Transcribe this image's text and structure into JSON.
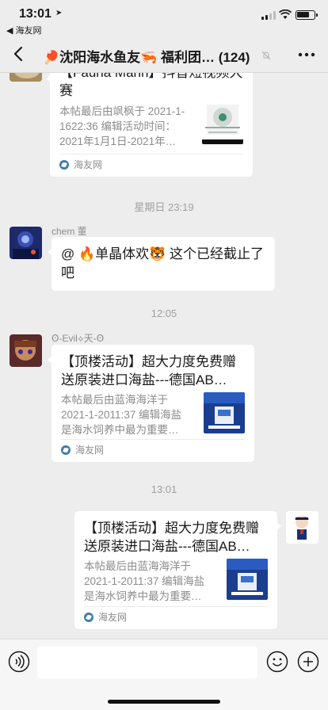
{
  "status": {
    "time": "13:01",
    "back_app": "◀ 海友网"
  },
  "nav": {
    "title": "🏓沈阳海水鱼友🦐 福利团… (124)"
  },
  "messages": {
    "card0": {
      "title": "【Fauna Marin】抖音短视频大赛",
      "desc": "本帖最后由飒枫于 2021-1-1622:36 编辑活动时间：2021年1月1日-2021年…",
      "source": "海友网"
    },
    "sep1": "星期日 23:19",
    "msg1": {
      "sender": "chem 董",
      "text": "@ 🔥单晶体欢🐯 这个已经截止了吧"
    },
    "sep2": "12:05",
    "msg2": {
      "sender": "Ꙩ-Evil⟡天-Ꙩ",
      "title": "【顶楼活动】超大力度免费赠送原装进口海盐---德国AB…",
      "desc": "本帖最后由蓝海海洋于 2021-1-2011:37 编辑海盐是海水饲养中最为重要…",
      "source": "海友网"
    },
    "sep3": "13:01",
    "msg3": {
      "title": "【顶楼活动】超大力度免费赠送原装进口海盐---德国AB…",
      "desc": "本帖最后由蓝海海洋于 2021-1-2011:37 编辑海盐是海水饲养中最为重要…",
      "source": "海友网"
    }
  },
  "input": {
    "placeholder": ""
  },
  "colors": {
    "background": "#ededed",
    "bubble": "#ffffff",
    "meta_text": "#8c8c8c",
    "source_icon": "#3d7ea6"
  },
  "icons": {
    "back": "chevron-left-icon",
    "mute": "bell-off-icon",
    "more": "more-dots-icon",
    "voice": "voice-icon",
    "emoji": "emoji-icon",
    "plus": "plus-icon"
  }
}
